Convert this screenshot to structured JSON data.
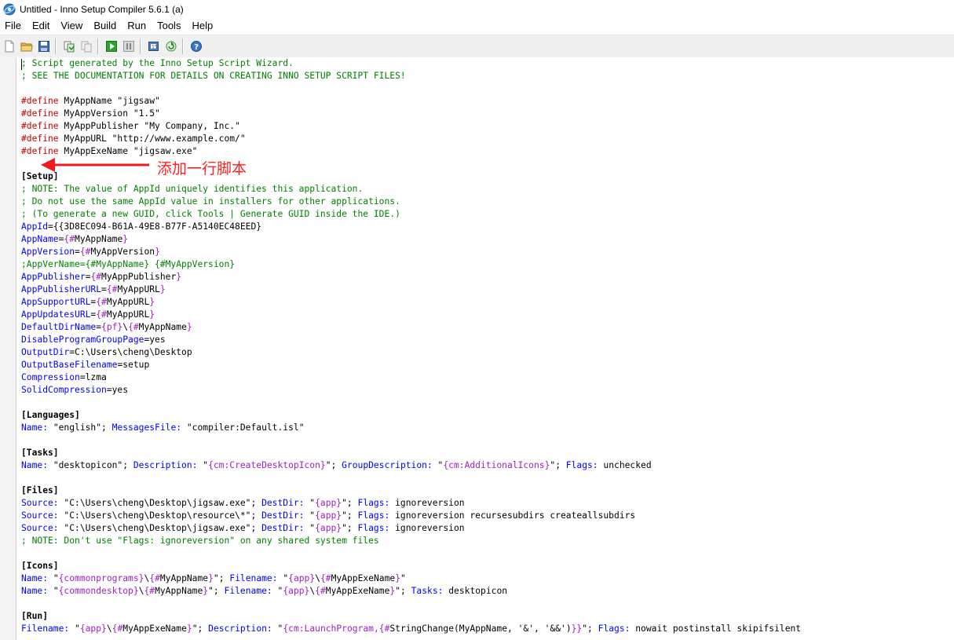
{
  "window": {
    "title": "Untitled - Inno Setup Compiler 5.6.1 (a)",
    "icon": "inno-setup-app-icon"
  },
  "menu": [
    "File",
    "Edit",
    "View",
    "Build",
    "Run",
    "Tools",
    "Help"
  ],
  "toolbar": [
    {
      "icon": "new-file-icon"
    },
    {
      "icon": "open-folder-icon"
    },
    {
      "icon": "save-icon"
    },
    {
      "sep": true
    },
    {
      "icon": "compile-icon"
    },
    {
      "icon": "stop-compile-icon"
    },
    {
      "sep": true
    },
    {
      "icon": "run-icon"
    },
    {
      "icon": "pause-icon"
    },
    {
      "sep": true
    },
    {
      "icon": "target-icon"
    },
    {
      "icon": "refresh-icon"
    },
    {
      "sep": true
    },
    {
      "icon": "help-icon"
    }
  ],
  "colors": {
    "comment": "#008000",
    "directive": "#c00000",
    "key": "#0000ff",
    "constant": "#a020c0",
    "annotation": "#ff2020"
  },
  "annotation": {
    "label": "添加一行脚本"
  },
  "code": [
    [
      [
        "comment",
        "; Script generated by the Inno Setup Script Wizard."
      ]
    ],
    [
      [
        "comment",
        "; SEE THE DOCUMENTATION FOR DETAILS ON CREATING INNO SETUP SCRIPT FILES!"
      ]
    ],
    [],
    [
      [
        "pp",
        "#define"
      ],
      [
        "text",
        " MyAppName \"jigsaw\""
      ]
    ],
    [
      [
        "pp",
        "#define"
      ],
      [
        "text",
        " MyAppVersion \"1.5\""
      ]
    ],
    [
      [
        "pp",
        "#define"
      ],
      [
        "text",
        " MyAppPublisher \"My Company, Inc.\""
      ]
    ],
    [
      [
        "pp",
        "#define"
      ],
      [
        "text",
        " MyAppURL \"http://www.example.com/\""
      ]
    ],
    [
      [
        "pp",
        "#define"
      ],
      [
        "text",
        " MyAppExeName \"jigsaw.exe\""
      ]
    ],
    [],
    [
      [
        "section",
        "[Setup]"
      ]
    ],
    [
      [
        "comment",
        "; NOTE: The value of AppId uniquely identifies this application."
      ]
    ],
    [
      [
        "comment",
        "; Do not use the same AppId value in installers for other applications."
      ]
    ],
    [
      [
        "comment",
        "; (To generate a new GUID, click Tools | Generate GUID inside the IDE.)"
      ]
    ],
    [
      [
        "key",
        "AppId"
      ],
      [
        "text",
        "={{3D8EC094-B61A-49E8-B77F-A5140EC48EED}"
      ]
    ],
    [
      [
        "key",
        "AppName"
      ],
      [
        "text",
        "="
      ],
      [
        "const",
        "{#"
      ],
      [
        "text",
        "MyAppName"
      ],
      [
        "const",
        "}"
      ]
    ],
    [
      [
        "key",
        "AppVersion"
      ],
      [
        "text",
        "="
      ],
      [
        "const",
        "{#"
      ],
      [
        "text",
        "MyAppVersion"
      ],
      [
        "const",
        "}"
      ]
    ],
    [
      [
        "comment",
        ";AppVerName={#MyAppName} {#MyAppVersion}"
      ]
    ],
    [
      [
        "key",
        "AppPublisher"
      ],
      [
        "text",
        "="
      ],
      [
        "const",
        "{#"
      ],
      [
        "text",
        "MyAppPublisher"
      ],
      [
        "const",
        "}"
      ]
    ],
    [
      [
        "key",
        "AppPublisherURL"
      ],
      [
        "text",
        "="
      ],
      [
        "const",
        "{#"
      ],
      [
        "text",
        "MyAppURL"
      ],
      [
        "const",
        "}"
      ]
    ],
    [
      [
        "key",
        "AppSupportURL"
      ],
      [
        "text",
        "="
      ],
      [
        "const",
        "{#"
      ],
      [
        "text",
        "MyAppURL"
      ],
      [
        "const",
        "}"
      ]
    ],
    [
      [
        "key",
        "AppUpdatesURL"
      ],
      [
        "text",
        "="
      ],
      [
        "const",
        "{#"
      ],
      [
        "text",
        "MyAppURL"
      ],
      [
        "const",
        "}"
      ]
    ],
    [
      [
        "key",
        "DefaultDirName"
      ],
      [
        "text",
        "="
      ],
      [
        "const",
        "{pf}"
      ],
      [
        "text",
        "\\"
      ],
      [
        "const",
        "{#"
      ],
      [
        "text",
        "MyAppName"
      ],
      [
        "const",
        "}"
      ]
    ],
    [
      [
        "key",
        "DisableProgramGroupPage"
      ],
      [
        "text",
        "=yes"
      ]
    ],
    [
      [
        "key",
        "OutputDir"
      ],
      [
        "text",
        "=C:\\Users\\cheng\\Desktop"
      ]
    ],
    [
      [
        "key",
        "OutputBaseFilename"
      ],
      [
        "text",
        "=setup"
      ]
    ],
    [
      [
        "key",
        "Compression"
      ],
      [
        "text",
        "=lzma"
      ]
    ],
    [
      [
        "key",
        "SolidCompression"
      ],
      [
        "text",
        "=yes"
      ]
    ],
    [],
    [
      [
        "section",
        "[Languages]"
      ]
    ],
    [
      [
        "key",
        "Name:"
      ],
      [
        "text",
        " \"english\"; "
      ],
      [
        "key",
        "MessagesFile:"
      ],
      [
        "text",
        " \"compiler:Default.isl\""
      ]
    ],
    [],
    [
      [
        "section",
        "[Tasks]"
      ]
    ],
    [
      [
        "key",
        "Name:"
      ],
      [
        "text",
        " \"desktopicon\"; "
      ],
      [
        "key",
        "Description:"
      ],
      [
        "text",
        " \""
      ],
      [
        "const",
        "{cm:CreateDesktopIcon}"
      ],
      [
        "text",
        "\"; "
      ],
      [
        "key",
        "GroupDescription:"
      ],
      [
        "text",
        " \""
      ],
      [
        "const",
        "{cm:AdditionalIcons}"
      ],
      [
        "text",
        "\"; "
      ],
      [
        "key",
        "Flags:"
      ],
      [
        "text",
        " unchecked"
      ]
    ],
    [],
    [
      [
        "section",
        "[Files]"
      ]
    ],
    [
      [
        "key",
        "Source:"
      ],
      [
        "text",
        " \"C:\\Users\\cheng\\Desktop\\jigsaw.exe\"; "
      ],
      [
        "key",
        "DestDir:"
      ],
      [
        "text",
        " \""
      ],
      [
        "const",
        "{app}"
      ],
      [
        "text",
        "\"; "
      ],
      [
        "key",
        "Flags:"
      ],
      [
        "text",
        " ignoreversion"
      ]
    ],
    [
      [
        "key",
        "Source:"
      ],
      [
        "text",
        " \"C:\\Users\\cheng\\Desktop\\resource\\*\"; "
      ],
      [
        "key",
        "DestDir:"
      ],
      [
        "text",
        " \""
      ],
      [
        "const",
        "{app}"
      ],
      [
        "text",
        "\"; "
      ],
      [
        "key",
        "Flags:"
      ],
      [
        "text",
        " ignoreversion recursesubdirs createallsubdirs"
      ]
    ],
    [
      [
        "key",
        "Source:"
      ],
      [
        "text",
        " \"C:\\Users\\cheng\\Desktop\\jigsaw.exe\"; "
      ],
      [
        "key",
        "DestDir:"
      ],
      [
        "text",
        " \""
      ],
      [
        "const",
        "{app}"
      ],
      [
        "text",
        "\"; "
      ],
      [
        "key",
        "Flags:"
      ],
      [
        "text",
        " ignoreversion"
      ]
    ],
    [
      [
        "comment",
        "; NOTE: Don't use \"Flags: ignoreversion\" on any shared system files"
      ]
    ],
    [],
    [
      [
        "section",
        "[Icons]"
      ]
    ],
    [
      [
        "key",
        "Name:"
      ],
      [
        "text",
        " \""
      ],
      [
        "const",
        "{commonprograms}"
      ],
      [
        "text",
        "\\"
      ],
      [
        "const",
        "{#"
      ],
      [
        "text",
        "MyAppName"
      ],
      [
        "const",
        "}"
      ],
      [
        "text",
        "\"; "
      ],
      [
        "key",
        "Filename:"
      ],
      [
        "text",
        " \""
      ],
      [
        "const",
        "{app}"
      ],
      [
        "text",
        "\\"
      ],
      [
        "const",
        "{#"
      ],
      [
        "text",
        "MyAppExeName"
      ],
      [
        "const",
        "}"
      ],
      [
        "text",
        "\""
      ]
    ],
    [
      [
        "key",
        "Name:"
      ],
      [
        "text",
        " \""
      ],
      [
        "const",
        "{commondesktop}"
      ],
      [
        "text",
        "\\"
      ],
      [
        "const",
        "{#"
      ],
      [
        "text",
        "MyAppName"
      ],
      [
        "const",
        "}"
      ],
      [
        "text",
        "\"; "
      ],
      [
        "key",
        "Filename:"
      ],
      [
        "text",
        " \""
      ],
      [
        "const",
        "{app}"
      ],
      [
        "text",
        "\\"
      ],
      [
        "const",
        "{#"
      ],
      [
        "text",
        "MyAppExeName"
      ],
      [
        "const",
        "}"
      ],
      [
        "text",
        "\"; "
      ],
      [
        "key",
        "Tasks:"
      ],
      [
        "text",
        " desktopicon"
      ]
    ],
    [],
    [
      [
        "section",
        "[Run]"
      ]
    ],
    [
      [
        "key",
        "Filename:"
      ],
      [
        "text",
        " \""
      ],
      [
        "const",
        "{app}"
      ],
      [
        "text",
        "\\"
      ],
      [
        "const",
        "{#"
      ],
      [
        "text",
        "MyAppExeName"
      ],
      [
        "const",
        "}"
      ],
      [
        "text",
        "\"; "
      ],
      [
        "key",
        "Description:"
      ],
      [
        "text",
        " \""
      ],
      [
        "const",
        "{cm:LaunchProgram,{#"
      ],
      [
        "text",
        "StringChange(MyAppName, '&', '&&')"
      ],
      [
        "const",
        "}}"
      ],
      [
        "text",
        "\"; "
      ],
      [
        "key",
        "Flags:"
      ],
      [
        "text",
        " nowait postinstall skipifsilent"
      ]
    ]
  ]
}
